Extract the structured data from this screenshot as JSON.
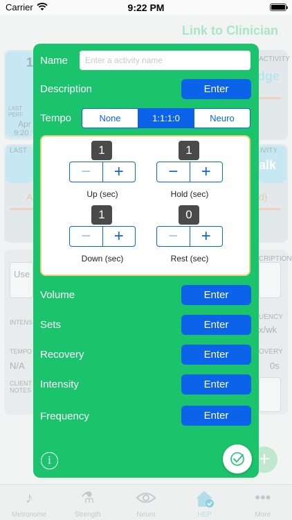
{
  "status_bar": {
    "carrier": "Carrier",
    "time": "9:22 PM"
  },
  "background": {
    "link_clinician": "Link to Clinician",
    "card1_number": "1",
    "card1_small": "LAST PERF",
    "card1_date": "Apr",
    "card1_time": "9:20",
    "card1_right_label": "ACTIVITY",
    "card1_right_big": "dge",
    "card2_left_label": "LAST",
    "card2_right_label": "IVITY",
    "card2_right_big": "alk",
    "card2_a": "A",
    "card2_d": "d)",
    "use_placeholder": "Use",
    "description_label": "CRIPTION",
    "intensity_label": "INTENS",
    "frequency_label": "UENCY",
    "frequency_value": "x/wk",
    "tempo_label": "TEMPO",
    "tempo_value": "N/A",
    "recovery_label": "OVERY",
    "recovery_value": "0s",
    "client_notes_label": "CLIENT NOTES",
    "fab_symbol": "+"
  },
  "tab_bar": [
    {
      "label": "Metronome",
      "icon": "music-note-icon"
    },
    {
      "label": "Strength",
      "icon": "strength-icon"
    },
    {
      "label": "Neuro",
      "icon": "eye-icon"
    },
    {
      "label": "HEP",
      "icon": "home-check-icon"
    },
    {
      "label": "More",
      "icon": "more-icon"
    }
  ],
  "modal": {
    "name_label": "Name",
    "name_value": "",
    "name_placeholder": "Enter a activity name",
    "description_label": "Description",
    "description_button": "Enter",
    "tempo_label": "Tempo",
    "tempo_options": [
      "None",
      "1:1:1:0",
      "Neuro"
    ],
    "tempo_selected": "1:1:1:0",
    "steppers": {
      "up": {
        "value": "1",
        "label": "Up (sec)"
      },
      "hold": {
        "value": "1",
        "label": "Hold (sec)"
      },
      "down": {
        "value": "1",
        "label": "Down (sec)"
      },
      "rest": {
        "value": "0",
        "label": "Rest (sec)"
      }
    },
    "stepper_minus": "−",
    "stepper_plus": "+",
    "volume_label": "Volume",
    "sets_label": "Sets",
    "recovery_label": "Recovery",
    "intensity_label": "Intensity",
    "frequency_label": "Frequency",
    "enter_label": "Enter",
    "info_symbol": "i"
  },
  "colors": {
    "modal_green": "#1bc46c",
    "button_blue": "#0a63e8",
    "panel_border": "#e6d27a"
  }
}
